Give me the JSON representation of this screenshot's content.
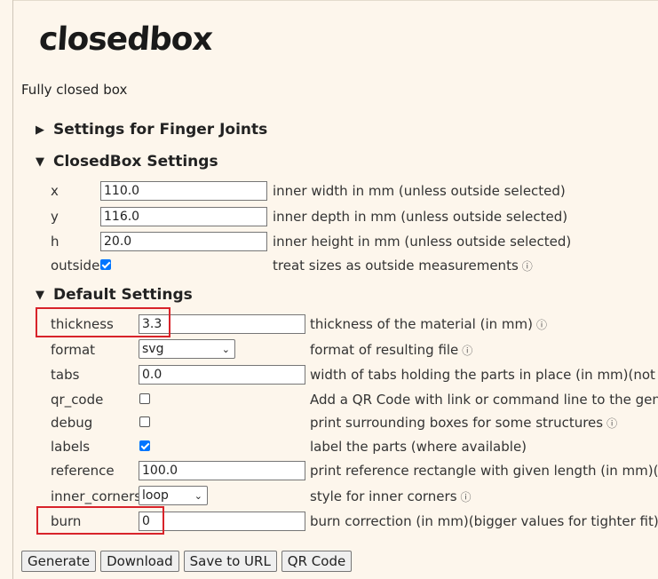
{
  "app": {
    "logo": "closedbox",
    "description": "Fully closed box"
  },
  "sections": {
    "finger": "Settings for Finger Joints",
    "closedbox": "ClosedBox Settings",
    "default": "Default Settings"
  },
  "closedbox": {
    "x": {
      "label": "x",
      "value": "110.0",
      "hint": "inner width in mm (unless outside selected)"
    },
    "y": {
      "label": "y",
      "value": "116.0",
      "hint": "inner depth in mm (unless outside selected)"
    },
    "h": {
      "label": "h",
      "value": "20.0",
      "hint": "inner height in mm (unless outside selected)"
    },
    "outside": {
      "label": "outside",
      "checked": true,
      "hint": "treat sizes as outside measurements"
    }
  },
  "defaults": {
    "thickness": {
      "label": "thickness",
      "value": "3.3",
      "hint": "thickness of the material (in mm)"
    },
    "format": {
      "label": "format",
      "value": "svg",
      "hint": "format of resulting file"
    },
    "tabs": {
      "label": "tabs",
      "value": "0.0",
      "hint": "width of tabs holding the parts in place (in mm)(not sup"
    },
    "qr_code": {
      "label": "qr_code",
      "checked": false,
      "hint": "Add a QR Code with link or command line to the genera"
    },
    "debug": {
      "label": "debug",
      "checked": false,
      "hint": "print surrounding boxes for some structures"
    },
    "labels": {
      "label": "labels",
      "checked": true,
      "hint": "label the parts (where available)"
    },
    "reference": {
      "label": "reference",
      "value": "100.0",
      "hint": "print reference rectangle with given length (in mm)(zerc"
    },
    "inner_corners": {
      "label": "inner_corners",
      "value": "loop",
      "hint": "style for inner corners"
    },
    "burn": {
      "label": "burn",
      "value": "0",
      "hint": "burn correction (in mm)(bigger values for tighter fit)"
    }
  },
  "info_glyph": "ⓘ",
  "buttons": {
    "generate": "Generate",
    "download": "Download",
    "save_url": "Save to URL",
    "qr_code": "QR Code"
  },
  "colors": {
    "background": "#fdf6ec",
    "highlight": "#d8232a",
    "checkbox": "#0075ff"
  }
}
